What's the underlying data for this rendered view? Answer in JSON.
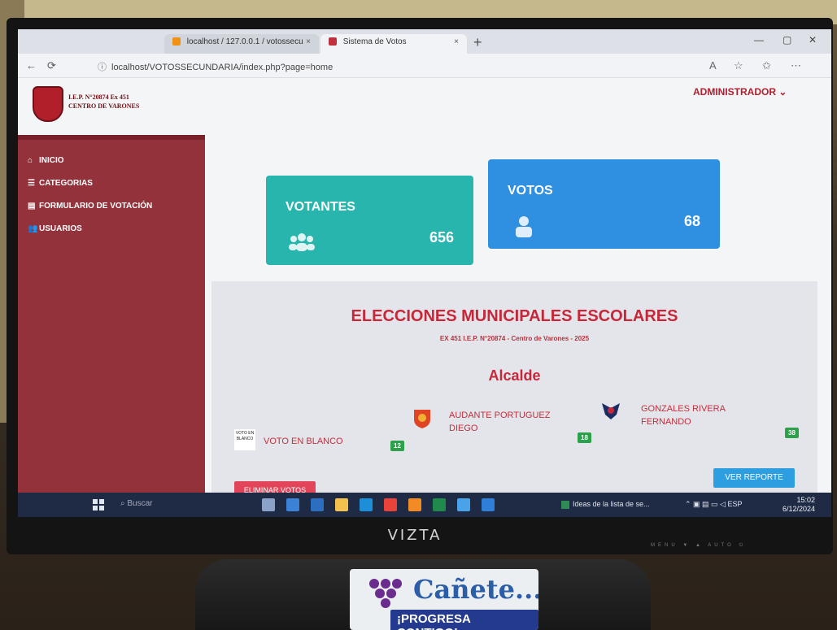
{
  "browser": {
    "tabs": [
      {
        "label": "localhost / 127.0.0.1 / votossecu",
        "close": "×"
      },
      {
        "label": "Sistema de Votos",
        "close": "×"
      }
    ],
    "new_tab": "+",
    "url": "localhost/VOTOSSECUNDARIA/index.php?page=home",
    "window_controls": [
      "—",
      "▢",
      "✕"
    ]
  },
  "sidebar": {
    "school_name_line1": "I.E.P. N°20874 Ex 451",
    "school_name_line2": "CENTRO DE VARONES",
    "items": [
      {
        "icon": "home-icon",
        "label": "INICIO"
      },
      {
        "icon": "list-icon",
        "label": "CATEGORIAS"
      },
      {
        "icon": "form-icon",
        "label": "FORMULARIO DE VOTACIÓN"
      },
      {
        "icon": "users-icon",
        "label": "USUARIOS"
      }
    ]
  },
  "header": {
    "user": "ADMINISTRADOR ⌄"
  },
  "cards": {
    "votantes": {
      "title": "VOTANTES",
      "value": "656",
      "icon": "users-group-icon",
      "color": "#27b5ad"
    },
    "votos": {
      "title": "VOTOS",
      "value": "68",
      "icon": "person-icon",
      "color": "#2f8fe0"
    }
  },
  "election": {
    "title": "ELECCIONES MUNICIPALES ESCOLARES",
    "subtitle": "EX 451 I.E.P. N°20874 - Centro de Varones - 2025",
    "role": "Alcalde",
    "candidates": [
      {
        "name_line1": "VOTO EN BLANCO",
        "name_line2": "",
        "image_text": "VOTO EN BLANCO",
        "votes": "12"
      },
      {
        "name_line1": "AUDANTE PORTUGUEZ",
        "name_line2": "DIEGO",
        "votes": "18"
      },
      {
        "name_line1": "GONZALES RIVERA",
        "name_line2": "FERNANDO",
        "votes": "38"
      }
    ],
    "delete_button": "ELIMINAR VOTOS",
    "report_button": "VER REPORTE"
  },
  "taskbar": {
    "search": "Buscar",
    "news": "Ideas de la lista de se...",
    "lang": "ESP",
    "time": "15:02",
    "date": "6/12/2024"
  },
  "monitor": {
    "brand": "VIZTA",
    "controls": "MENU  ▼  ▲  AUTO  ⏻"
  },
  "sticker": {
    "title": "Cañete...",
    "slogan": "¡PROGRESA CONTIGO!"
  },
  "colors": {
    "accent_red": "#c6283a",
    "sidebar": "#93323a",
    "teal": "#27b5ad",
    "blue": "#2f8fe0"
  }
}
